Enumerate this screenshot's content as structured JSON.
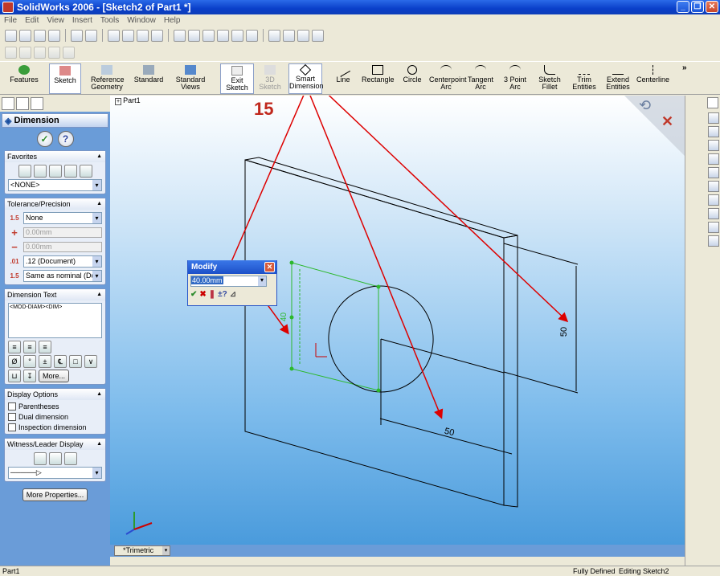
{
  "window": {
    "title": "SolidWorks 2006 - [Sketch2 of Part1 *]"
  },
  "menu": [
    "File",
    "Edit",
    "View",
    "Insert",
    "Tools",
    "Window",
    "Help"
  ],
  "command_manager": {
    "items": [
      {
        "label": "Features"
      },
      {
        "label": "Sketch"
      },
      {
        "label": "Reference Geometry"
      },
      {
        "label": "Standard"
      },
      {
        "label": "Standard Views"
      },
      {
        "label": "Exit Sketch"
      },
      {
        "label": "3D Sketch"
      },
      {
        "label": "Smart Dimension"
      },
      {
        "label": "Line"
      },
      {
        "label": "Rectangle"
      },
      {
        "label": "Circle"
      },
      {
        "label": "Centerpoint Arc"
      },
      {
        "label": "Tangent Arc"
      },
      {
        "label": "3 Point Arc"
      },
      {
        "label": "Sketch Fillet"
      },
      {
        "label": "Trim Entities"
      },
      {
        "label": "Extend Entities"
      },
      {
        "label": "Centerline"
      }
    ]
  },
  "property_manager": {
    "title": "Dimension",
    "favorites": {
      "header": "Favorites",
      "value": "<NONE>"
    },
    "tolerance": {
      "header": "Tolerance/Precision",
      "type": "None",
      "max": "0.00mm",
      "min": "0.00mm",
      "precision": ".12 (Document)",
      "tol_precision": "Same as nominal (Doc"
    },
    "dimension_text": {
      "header": "Dimension Text",
      "value": "<MOD-DIAM><DIM>",
      "more": "More..."
    },
    "display_options": {
      "header": "Display Options",
      "parentheses": "Parentheses",
      "dual": "Dual dimension",
      "inspection": "Inspection dimension"
    },
    "witness": {
      "header": "Witness/Leader Display"
    },
    "more_properties": "More Properties..."
  },
  "graphics": {
    "tree_root": "Part1",
    "step_label": "15",
    "dim_vertical": "50",
    "dim_horizontal": "50",
    "dim_circle": "40",
    "view_name": "*Trimetric"
  },
  "modify_dialog": {
    "title": "Modify",
    "value": "40.00mm"
  },
  "status": {
    "left": "Part1",
    "state": "Fully Defined",
    "mode": "Editing Sketch2"
  }
}
